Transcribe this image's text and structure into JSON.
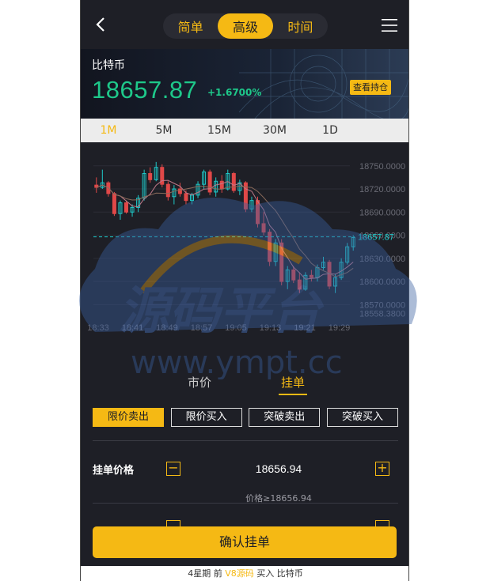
{
  "header": {
    "modes": [
      "简单",
      "高级",
      "时间"
    ],
    "active_mode": 1
  },
  "ticker": {
    "name": "比特币",
    "price": "18657.87",
    "change": "+1.6700%",
    "holdings_label": "查看持仓"
  },
  "timeframes": {
    "items": [
      "1M",
      "5M",
      "15M",
      "30M",
      "1D"
    ],
    "active": 0
  },
  "chart_data": {
    "type": "candlestick",
    "x_ticks": [
      "18:33",
      "18:41",
      "18:49",
      "18:57",
      "19:05",
      "19:13",
      "19:21",
      "19:29"
    ],
    "y_ticks": [
      "18750.0000",
      "18720.0000",
      "18690.0000",
      "18660.0000",
      "18630.0000",
      "18600.0000",
      "18570.0000",
      "18558.3800"
    ],
    "ylim": [
      18555,
      18760
    ],
    "last_price": "18657.87",
    "last_price_value": 18657.87,
    "candles": [
      [
        18725,
        18735,
        18715,
        18722
      ],
      [
        18722,
        18745,
        18720,
        18728
      ],
      [
        18728,
        18730,
        18710,
        18714
      ],
      [
        18714,
        18716,
        18685,
        18688
      ],
      [
        18688,
        18705,
        18680,
        18702
      ],
      [
        18702,
        18705,
        18688,
        18690
      ],
      [
        18690,
        18700,
        18684,
        18696
      ],
      [
        18696,
        18712,
        18690,
        18708
      ],
      [
        18708,
        18745,
        18705,
        18740
      ],
      [
        18740,
        18748,
        18728,
        18732
      ],
      [
        18732,
        18755,
        18730,
        18748
      ],
      [
        18748,
        18752,
        18722,
        18726
      ],
      [
        18726,
        18730,
        18705,
        18710
      ],
      [
        18710,
        18725,
        18700,
        18720
      ],
      [
        18720,
        18728,
        18710,
        18714
      ],
      [
        18714,
        18718,
        18700,
        18705
      ],
      [
        18705,
        18715,
        18700,
        18712
      ],
      [
        18712,
        18730,
        18708,
        18726
      ],
      [
        18726,
        18745,
        18720,
        18742
      ],
      [
        18742,
        18745,
        18712,
        18716
      ],
      [
        18716,
        18735,
        18710,
        18730
      ],
      [
        18730,
        18738,
        18715,
        18720
      ],
      [
        18720,
        18745,
        18718,
        18740
      ],
      [
        18740,
        18742,
        18715,
        18718
      ],
      [
        18718,
        18732,
        18712,
        18728
      ],
      [
        18728,
        18730,
        18690,
        18694
      ],
      [
        18694,
        18710,
        18690,
        18705
      ],
      [
        18705,
        18710,
        18670,
        18675
      ],
      [
        18675,
        18690,
        18660,
        18664
      ],
      [
        18664,
        18668,
        18620,
        18626
      ],
      [
        18626,
        18655,
        18620,
        18650
      ],
      [
        18650,
        18655,
        18595,
        18600
      ],
      [
        18600,
        18620,
        18590,
        18615
      ],
      [
        18615,
        18620,
        18598,
        18602
      ],
      [
        18602,
        18612,
        18585,
        18590
      ],
      [
        18590,
        18612,
        18588,
        18608
      ],
      [
        18608,
        18615,
        18600,
        18605
      ],
      [
        18605,
        18622,
        18600,
        18618
      ],
      [
        18618,
        18632,
        18615,
        18625
      ],
      [
        18625,
        18628,
        18590,
        18594
      ],
      [
        18594,
        18610,
        18585,
        18605
      ],
      [
        18605,
        18630,
        18602,
        18625
      ],
      [
        18625,
        18650,
        18622,
        18645
      ],
      [
        18645,
        18660,
        18640,
        18657
      ]
    ]
  },
  "order": {
    "tabs": [
      "市价",
      "挂单"
    ],
    "active_tab": 1,
    "types": [
      "限价卖出",
      "限价买入",
      "突破卖出",
      "突破买入"
    ],
    "active_type": 0,
    "price_label": "挂单价格",
    "price_value": "18656.94",
    "price_hint": "价格≥18656.94",
    "minus": "−",
    "plus": "+",
    "confirm_label": "确认挂单"
  },
  "footer": {
    "prefix": "4星期 前",
    "highlight": "V8源码",
    "suffix": "买入 比特币"
  },
  "watermark": {
    "title": "源码平台",
    "url": "www.ympt.cc"
  },
  "colors": {
    "accent": "#f5b914",
    "up": "#1ec8c8",
    "down": "#e04848",
    "price_green": "#1ec88a",
    "bg": "#1e1f26"
  }
}
